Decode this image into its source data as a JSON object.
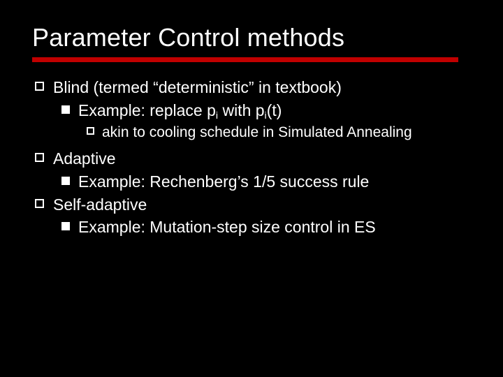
{
  "slide": {
    "title": "Parameter Control methods",
    "items": [
      {
        "text": "Blind (termed “deterministic” in textbook)",
        "children": [
          {
            "prefix": "Example: replace p",
            "sub1": "i",
            "mid": " with p",
            "sub2": "i",
            "suffix": "(t)",
            "children": [
              {
                "text": "akin to cooling schedule in Simulated Annealing"
              }
            ]
          }
        ]
      },
      {
        "text": "Adaptive",
        "children": [
          {
            "text": "Example: Rechenberg’s 1/5 success rule"
          }
        ]
      },
      {
        "text": "Self-adaptive",
        "children": [
          {
            "text": "Example: Mutation-step size control in ES"
          }
        ]
      }
    ]
  }
}
